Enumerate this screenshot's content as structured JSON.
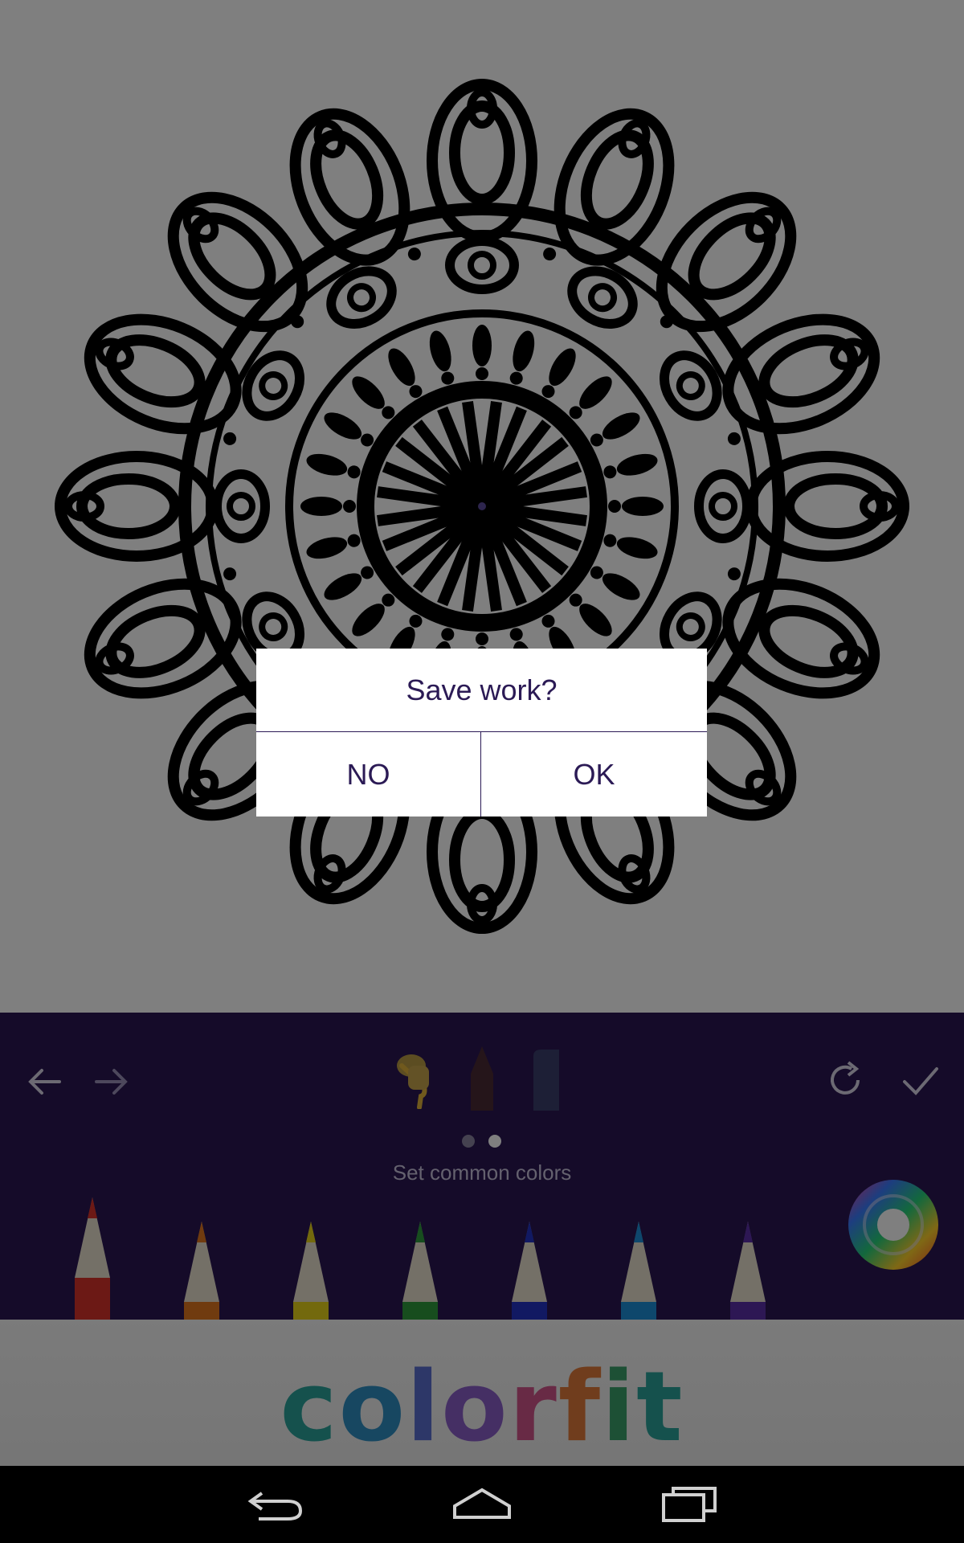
{
  "dialog": {
    "title": "Save work?",
    "no_label": "NO",
    "ok_label": "OK"
  },
  "toolbar": {
    "undo_icon": "arrow-left-icon",
    "redo_icon": "arrow-right-icon",
    "tools": [
      "paint-bucket-icon",
      "pencil-icon",
      "eraser-icon"
    ],
    "reset_icon": "refresh-icon",
    "done_icon": "checkmark-icon",
    "pager": {
      "count": 2,
      "active": 2
    },
    "caption": "Set common colors",
    "pencil_colors": [
      "#d8322a",
      "#e0761f",
      "#e6d21a",
      "#2e9b3c",
      "#2233c4",
      "#1d8fd8",
      "#5b2ea8"
    ],
    "color_wheel_icon": "color-wheel-icon"
  },
  "ad": {
    "logo_text": "colorfit"
  },
  "colors": {
    "toolbar_bg": "#2a1653",
    "dialog_text": "#2b1a55",
    "scrim": "rgba(0,0,0,0.5)"
  },
  "navbar": {
    "icons": [
      "back-icon",
      "home-icon",
      "recents-icon"
    ]
  }
}
